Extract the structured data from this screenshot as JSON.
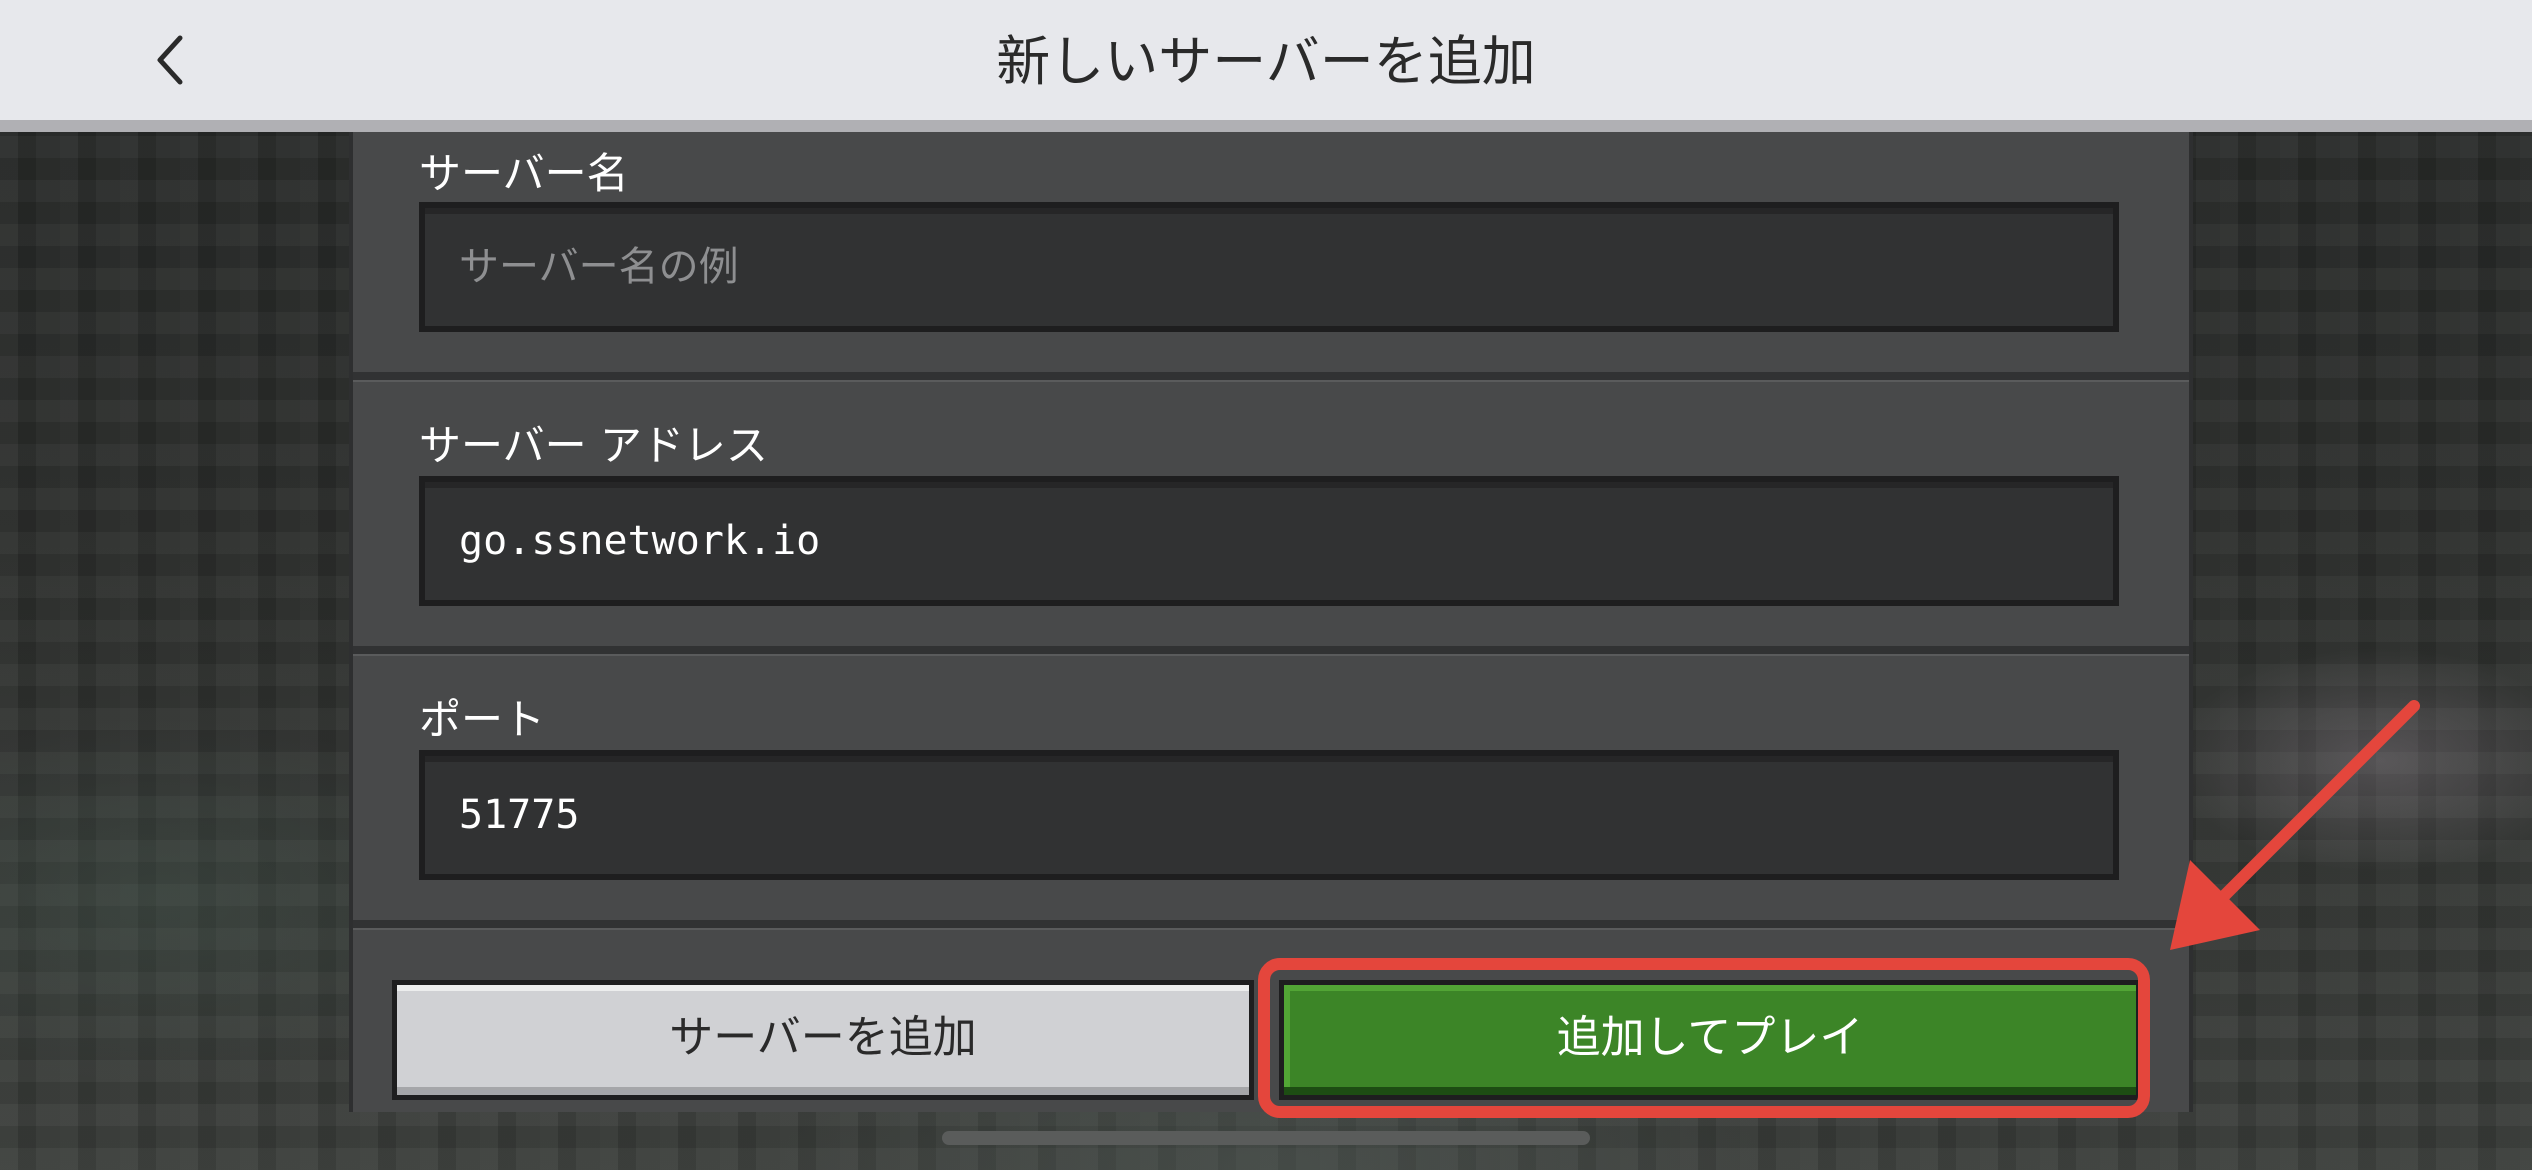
{
  "header": {
    "title": "新しいサーバーを追加",
    "back_icon": "chevron-left-icon"
  },
  "form": {
    "server_name": {
      "label": "サーバー名",
      "value": "",
      "placeholder": "サーバー名の例"
    },
    "server_address": {
      "label": "サーバー アドレス",
      "value": "go.ssnetwork.io"
    },
    "port": {
      "label": "ポート",
      "value": "51775"
    }
  },
  "buttons": {
    "add_server": "サーバーを追加",
    "add_and_play": "追加してプレイ"
  },
  "colors": {
    "primary": "#3c8527",
    "secondary": "#d0d1d4",
    "highlight": "#e4463c",
    "header": "#e7e8ec"
  }
}
